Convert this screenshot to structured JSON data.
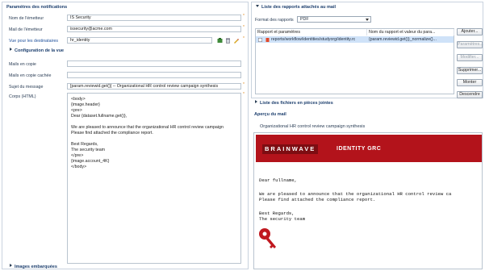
{
  "notification": {
    "section_title": "Paramètres des notifications",
    "sender_name_label": "Nom de l'émetteur",
    "sender_name_value": "IS Security",
    "sender_mail_label": "Mail de l'émetteur",
    "sender_mail_value": "issecurity@acme.com",
    "recipients_label": "Vue pour les destinataires",
    "recipients_value": "hr_identity",
    "view_config_title": "Configuration de la vue",
    "cc_label": "Mails en copie",
    "bcc_label": "Mails en copie cachée",
    "subject_label": "Sujet du message",
    "subject_value": "[param.reviewid.get()] -- Organizational HR control review campaign synthesis",
    "body_label": "Corps (HTML)",
    "body_value": "<body>\n{image.header}\n<pre>\nDear {dataset.fullname.get()},\n\nWe are pleased to announce that the organizational HR control review campaign\nPlease find attached the compliance report.\n\nBest Regards,\nThe security team\n</pre>\n{image.account_4K}\n</body>",
    "embedded_images_label": "Images embarquées"
  },
  "reports": {
    "section_title": "Liste des rapports attachés au mail",
    "format_label": "Format des rapports",
    "format_value": "PDF",
    "col_report": "Rapport et paramètres",
    "col_name": "Nom du rapport et valeur du para...",
    "row_report": "reports/workflow/identities/studyorg/identity.rc",
    "row_name": "{param.reviewid.get()}_normalize(}...",
    "btn_add": "Ajouter...",
    "btn_params": "Paramètres...",
    "btn_modify": "Modifier...",
    "btn_delete": "Supprimer...",
    "btn_up": "Monter",
    "btn_down": "Descendre"
  },
  "attachments": {
    "section_title": "Liste des fichiers en pièces jointes"
  },
  "preview": {
    "section_title": "Aperçu du mail",
    "subject": "Organizational HR control review campaign synthesis",
    "brand": "BRAINWAVE",
    "product": "IDENTITY GRC",
    "greeting": "Dear fullname,",
    "line1": "We are pleased to announce that the organizational HR control review ca",
    "line2": "Please find attached the compliance report.",
    "regards": "Best Regards,",
    "team": "The security team"
  },
  "colors": {
    "brand_red": "#b3131b",
    "header_blue": "#1d3f6e",
    "selection": "#cfe2f8"
  }
}
